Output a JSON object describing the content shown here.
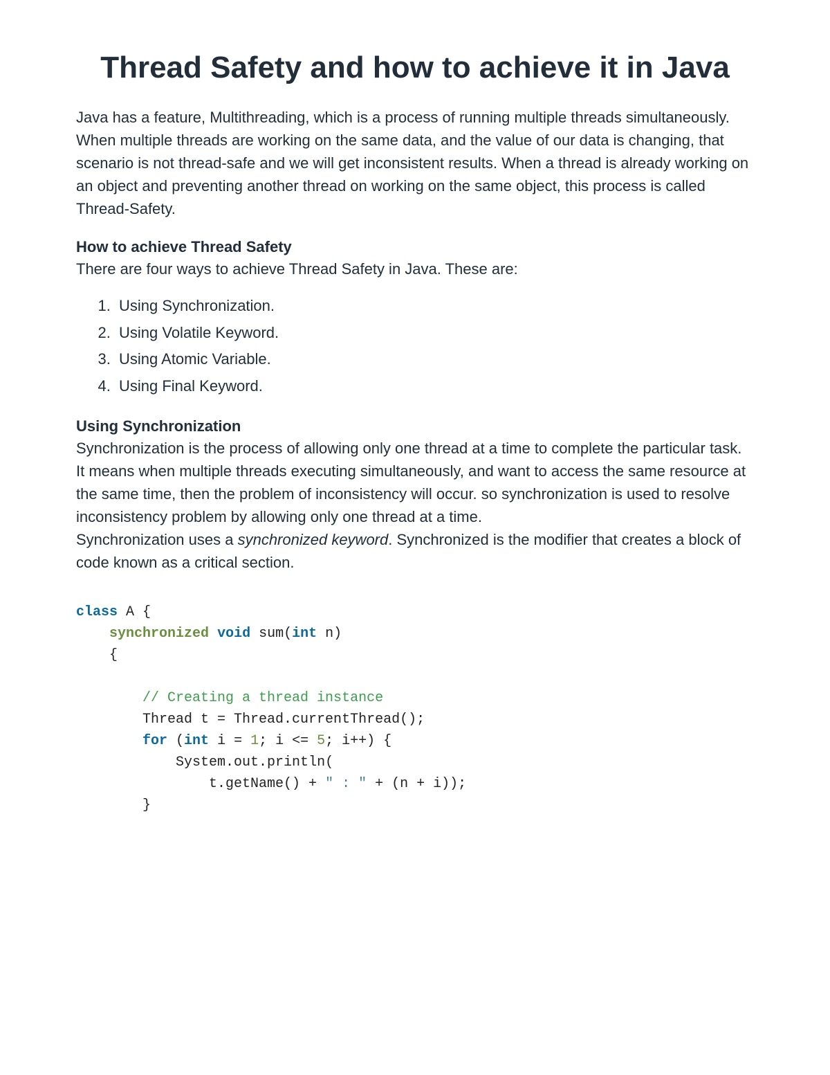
{
  "title": "Thread Safety and how to achieve it in Java",
  "intro": "Java has a feature, Multithreading, which is a process of running multiple threads simultaneously. When multiple threads are working on the same data, and the value of our data is changing, that scenario is not thread-safe and we will get inconsistent results. When a thread is already working on an object and preventing another thread on working on the same object, this process is called Thread-Safety.",
  "section_how": {
    "heading": "How to achieve Thread Safety",
    "lead": "There are four ways to achieve Thread Safety in Java. These are:",
    "items": [
      "Using Synchronization.",
      "Using Volatile Keyword.",
      "Using Atomic Variable.",
      "Using Final Keyword."
    ]
  },
  "section_sync": {
    "heading": "Using Synchronization",
    "para1": "Synchronization is the process of allowing only one thread at a time to complete the particular task. It means when multiple threads executing simultaneously, and want to access the same resource at the same time, then the problem of inconsistency will occur. so synchronization is used to resolve inconsistency problem by allowing only one thread at a time.",
    "para2_pre": "Synchronization uses a ",
    "para2_em": "synchronized keyword",
    "para2_post": ". Synchronized is the modifier that creates a block of code known as a critical section."
  },
  "code": {
    "kw_class": "class",
    "cls_name": " A {",
    "kw_sync": "synchronized",
    "kw_void": "void",
    "fn_sig_mid": " sum(",
    "kw_int": "int",
    "fn_sig_end": " n)",
    "brace_open": "{",
    "comment": "// Creating a thread instance",
    "line_thread": "Thread t = Thread.currentThread();",
    "kw_for": "for",
    "for_open": " (",
    "for_decl": " i = ",
    "num_1": "1",
    "for_cond": "; i <= ",
    "num_5": "5",
    "for_end": "; i++) {",
    "println": "System.out.println(",
    "expr_pre": "t.getName() + ",
    "str_colon": "\" : \"",
    "expr_post": " + (n + i));",
    "brace_close": "}"
  }
}
